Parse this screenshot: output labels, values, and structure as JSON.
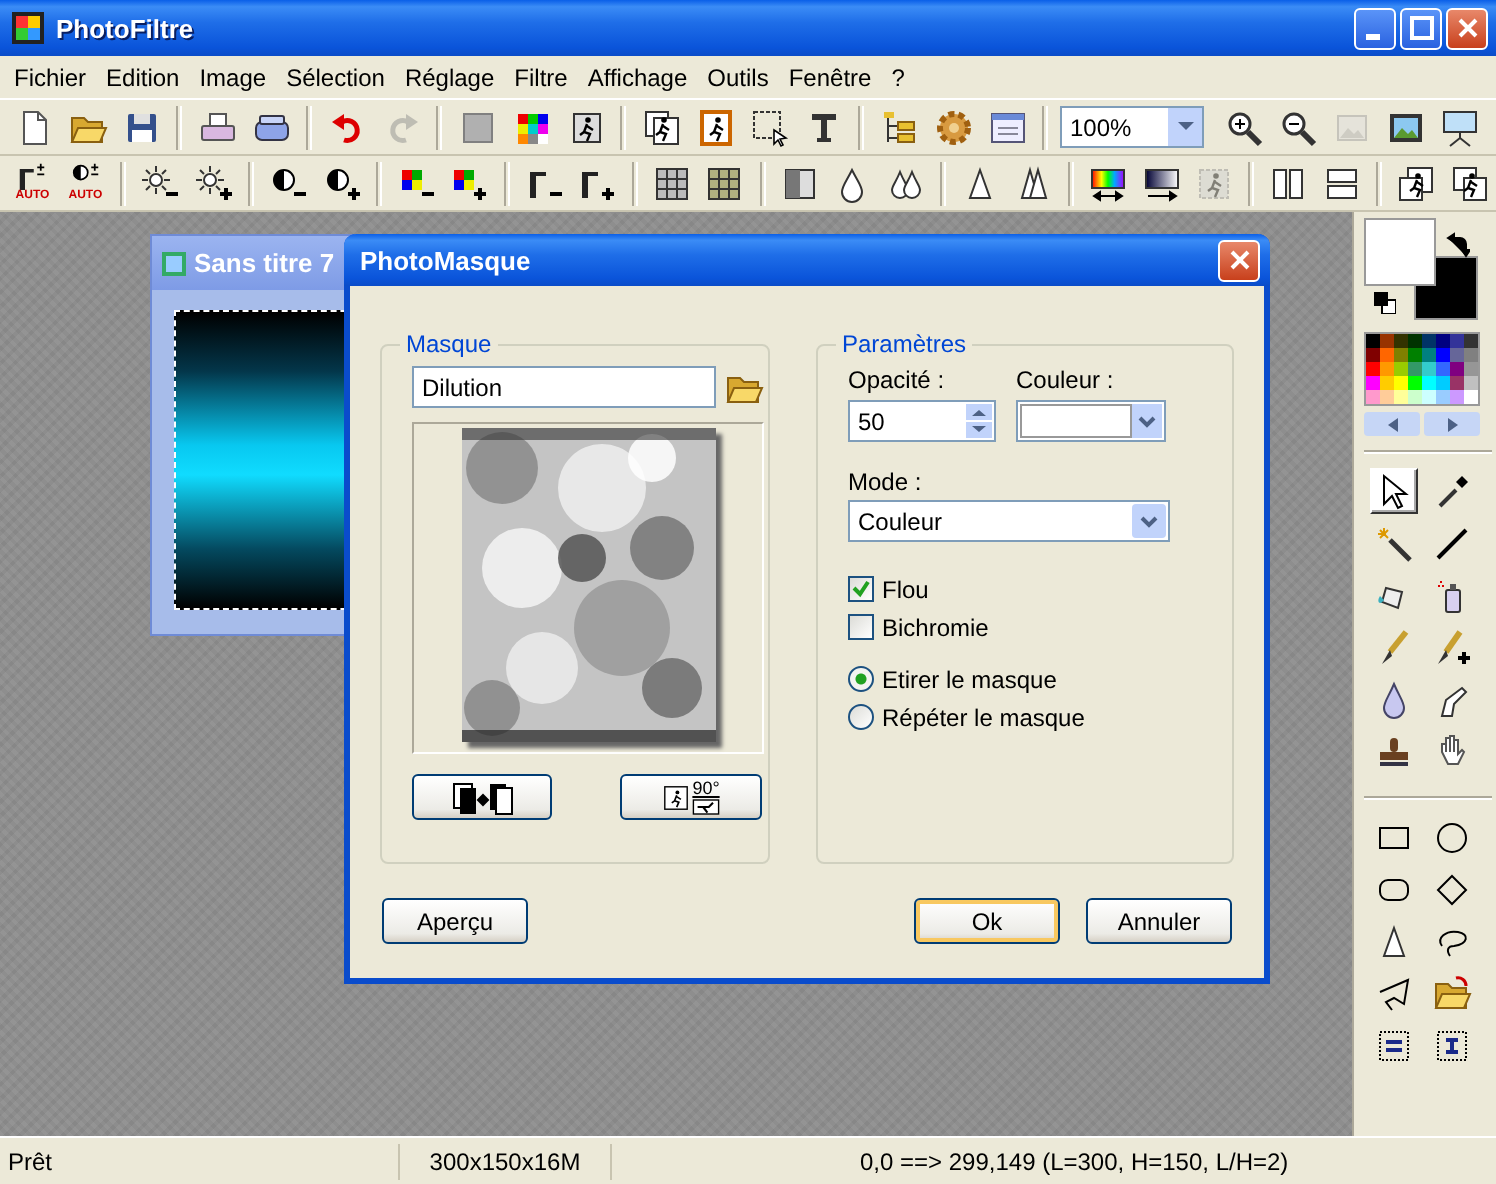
{
  "window": {
    "title": "PhotoFiltre"
  },
  "menu": [
    "Fichier",
    "Edition",
    "Image",
    "Sélection",
    "Réglage",
    "Filtre",
    "Affichage",
    "Outils",
    "Fenêtre",
    "?"
  ],
  "toolbar_1": [
    {
      "kind": "new",
      "disabled": false
    },
    {
      "kind": "open",
      "disabled": false
    },
    {
      "kind": "save",
      "disabled": false
    },
    {
      "kind": "separator"
    },
    {
      "kind": "print",
      "disabled": false
    },
    {
      "kind": "scan",
      "disabled": false
    },
    {
      "kind": "separator"
    },
    {
      "kind": "undo",
      "disabled": false
    },
    {
      "kind": "redo",
      "disabled": true
    },
    {
      "kind": "separator"
    },
    {
      "kind": "greysquare",
      "disabled": false
    },
    {
      "kind": "colorgrid",
      "disabled": false
    },
    {
      "kind": "maskfigure",
      "disabled": false
    },
    {
      "kind": "separator"
    },
    {
      "kind": "copyfigure",
      "disabled": false
    },
    {
      "kind": "framefigure",
      "disabled": false
    },
    {
      "kind": "selection",
      "disabled": false
    },
    {
      "kind": "text",
      "disabled": false
    },
    {
      "kind": "separator"
    },
    {
      "kind": "tree",
      "disabled": false
    },
    {
      "kind": "gear",
      "disabled": false
    },
    {
      "kind": "windowicon",
      "disabled": false
    },
    {
      "kind": "separator"
    },
    {
      "kind": "zoom",
      "value": "100%"
    },
    {
      "kind": "zoomin",
      "disabled": false
    },
    {
      "kind": "zoomout",
      "disabled": false
    },
    {
      "kind": "fit",
      "disabled": true
    },
    {
      "kind": "landscape",
      "disabled": false
    },
    {
      "kind": "projector",
      "disabled": false
    }
  ],
  "toolbar_2": [
    {
      "kind": "gammaauto",
      "label": "AUTO",
      "disabled": false
    },
    {
      "kind": "contrastauto",
      "label": "AUTO",
      "disabled": false
    },
    {
      "kind": "separator"
    },
    {
      "kind": "sunminus",
      "disabled": false
    },
    {
      "kind": "sunplus",
      "disabled": false
    },
    {
      "kind": "separator"
    },
    {
      "kind": "halfminus",
      "disabled": false
    },
    {
      "kind": "halfplus",
      "disabled": false
    },
    {
      "kind": "separator"
    },
    {
      "kind": "rgbminus",
      "disabled": false
    },
    {
      "kind": "rgbplus",
      "disabled": false
    },
    {
      "kind": "separator"
    },
    {
      "kind": "gammaminus",
      "disabled": false
    },
    {
      "kind": "gammaplus",
      "disabled": false
    },
    {
      "kind": "separator"
    },
    {
      "kind": "grid",
      "disabled": false
    },
    {
      "kind": "olivegrid",
      "disabled": false
    },
    {
      "kind": "separator"
    },
    {
      "kind": "shaded",
      "disabled": false
    },
    {
      "kind": "drop",
      "disabled": false
    },
    {
      "kind": "drops",
      "disabled": false
    },
    {
      "kind": "separator"
    },
    {
      "kind": "triangle",
      "disabled": false
    },
    {
      "kind": "triangles",
      "disabled": false
    },
    {
      "kind": "separator"
    },
    {
      "kind": "rainbow",
      "disabled": false
    },
    {
      "kind": "bluegradient",
      "disabled": false
    },
    {
      "kind": "figureframe",
      "disabled": true
    },
    {
      "kind": "separator"
    },
    {
      "kind": "pagesv",
      "disabled": false
    },
    {
      "kind": "pagesh",
      "disabled": false
    },
    {
      "kind": "separator"
    },
    {
      "kind": "transform1",
      "disabled": false
    },
    {
      "kind": "transform2",
      "disabled": false
    }
  ],
  "document": {
    "title": "Sans titre 7"
  },
  "dialog": {
    "title": "PhotoMasque",
    "mask": {
      "title": "Masque",
      "name": "Dilution",
      "rotate_label": "90°"
    },
    "params": {
      "title": "Paramètres",
      "opacity_label": "Opacité :",
      "opacity": "50",
      "color_label": "Couleur :",
      "mode_label": "Mode :",
      "mode": "Couleur",
      "checkboxes": [
        {
          "label": "Flou",
          "checked": true
        },
        {
          "label": "Bichromie",
          "checked": false
        }
      ],
      "radios": [
        {
          "label": "Etirer le masque",
          "selected": true
        },
        {
          "label": "Répéter le masque",
          "selected": false
        }
      ]
    },
    "buttons": [
      {
        "label": "Aperçu",
        "default": false
      },
      {
        "label": "Ok",
        "default": true
      },
      {
        "label": "Annuler",
        "default": false
      }
    ]
  },
  "colors": {
    "primary": {
      "color": "#ffffff"
    },
    "secondary": {
      "color": "#000000"
    }
  },
  "palette": [
    {
      "color": "#000000"
    },
    {
      "color": "#993300"
    },
    {
      "color": "#333300"
    },
    {
      "color": "#003300"
    },
    {
      "color": "#003366"
    },
    {
      "color": "#000080"
    },
    {
      "color": "#333399"
    },
    {
      "color": "#333333"
    },
    {
      "color": "#800000"
    },
    {
      "color": "#ff6600"
    },
    {
      "color": "#808000"
    },
    {
      "color": "#008000"
    },
    {
      "color": "#008080"
    },
    {
      "color": "#0000ff"
    },
    {
      "color": "#666699"
    },
    {
      "color": "#808080"
    },
    {
      "color": "#ff0000"
    },
    {
      "color": "#ff9900"
    },
    {
      "color": "#99cc00"
    },
    {
      "color": "#339966"
    },
    {
      "color": "#33cccc"
    },
    {
      "color": "#3366ff"
    },
    {
      "color": "#800080"
    },
    {
      "color": "#969696"
    },
    {
      "color": "#ff00ff"
    },
    {
      "color": "#ffcc00"
    },
    {
      "color": "#ffff00"
    },
    {
      "color": "#00ff00"
    },
    {
      "color": "#00ffff"
    },
    {
      "color": "#00ccff"
    },
    {
      "color": "#993366"
    },
    {
      "color": "#c0c0c0"
    },
    {
      "color": "#ff99cc"
    },
    {
      "color": "#ffcc99"
    },
    {
      "color": "#ffff99"
    },
    {
      "color": "#ccffcc"
    },
    {
      "color": "#ccffff"
    },
    {
      "color": "#99ccff"
    },
    {
      "color": "#cc99ff"
    },
    {
      "color": "#ffffff"
    }
  ],
  "tools": [
    {
      "kind": "pointer",
      "selected": true
    },
    {
      "kind": "eyedropper",
      "selected": false
    },
    {
      "kind": "wand",
      "selected": false
    },
    {
      "kind": "line",
      "selected": false
    },
    {
      "kind": "bucket",
      "selected": false
    },
    {
      "kind": "spray",
      "selected": false
    },
    {
      "kind": "brush",
      "selected": false
    },
    {
      "kind": "brushplus",
      "selected": false
    },
    {
      "kind": "blur",
      "selected": false
    },
    {
      "kind": "finger",
      "selected": false
    },
    {
      "kind": "stamp",
      "selected": false
    },
    {
      "kind": "hand",
      "selected": false
    }
  ],
  "shape_tools": [
    {
      "kind": "rect",
      "selected": false
    },
    {
      "kind": "ellipse",
      "selected": false
    },
    {
      "kind": "roundrect",
      "selected": false
    },
    {
      "kind": "diamond",
      "selected": false
    },
    {
      "kind": "triangle",
      "selected": false
    },
    {
      "kind": "lasso",
      "selected": false
    },
    {
      "kind": "polylasso",
      "selected": false
    },
    {
      "kind": "openfolder",
      "selected": false
    },
    {
      "kind": "dottedequals",
      "selected": false
    },
    {
      "kind": "dottedi",
      "selected": false
    }
  ],
  "status_bar": [
    "Prêt",
    "300x150x16M",
    "0,0 ==> 299,149 (L=300, H=150, L/H=2)"
  ]
}
